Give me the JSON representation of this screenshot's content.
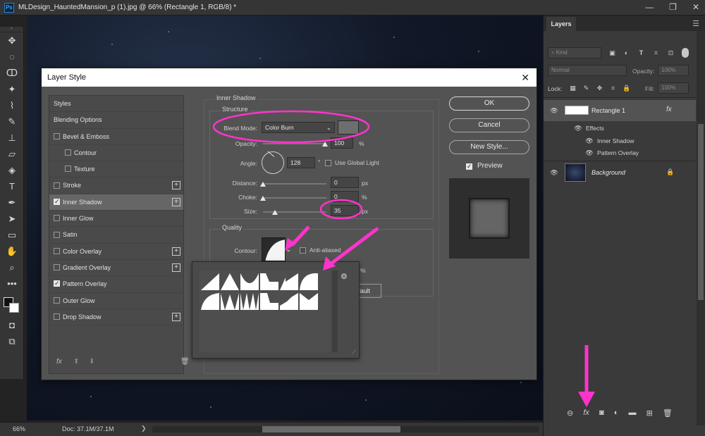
{
  "window": {
    "app_icon_label": "Ps",
    "title": "MLDesign_HauntedMansion_p (1).jpg @ 66% (Rectangle 1, RGB/8) *",
    "controls": [
      "—",
      "❐",
      "✕"
    ]
  },
  "statusbar": {
    "zoom": "66%",
    "doc": "Doc: 37.1M/37.1M",
    "arrow": "❯"
  },
  "layers_panel": {
    "tab": "Layers",
    "filter_placeholder": "Kind",
    "blend_mode": "Normal",
    "opacity_label": "Opacity:",
    "opacity_value": "100%",
    "lock_label": "Lock:",
    "fill_label": "Fill:",
    "fill_value": "100%",
    "layers": [
      {
        "name": "Rectangle 1",
        "fx": "fx"
      },
      {
        "name": "Background"
      }
    ],
    "effects_label": "Effects",
    "effects": [
      "Inner Shadow",
      "Pattern Overlay"
    ]
  },
  "dialog": {
    "title": "Layer Style",
    "close": "✕",
    "styles_header": "Styles",
    "style_items": [
      {
        "label": "Blending Options"
      },
      {
        "label": "Bevel & Emboss",
        "checked": false
      },
      {
        "label": "Contour",
        "checked": false,
        "sub": true
      },
      {
        "label": "Texture",
        "checked": false,
        "sub": true
      },
      {
        "label": "Stroke",
        "checked": false,
        "plus": true
      },
      {
        "label": "Inner Shadow",
        "checked": true,
        "plus": true,
        "selected": true
      },
      {
        "label": "Inner Glow",
        "checked": false
      },
      {
        "label": "Satin",
        "checked": false
      },
      {
        "label": "Color Overlay",
        "checked": false,
        "plus": true
      },
      {
        "label": "Gradient Overlay",
        "checked": false,
        "plus": true
      },
      {
        "label": "Pattern Overlay",
        "checked": true
      },
      {
        "label": "Outer Glow",
        "checked": false
      },
      {
        "label": "Drop Shadow",
        "checked": false,
        "plus": true
      }
    ],
    "inner_shadow": {
      "section_title": "Inner Shadow",
      "structure_title": "Structure",
      "blend_mode_label": "Blend Mode:",
      "blend_mode_value": "Color Burn",
      "shadow_color": "#6e6e6e",
      "opacity_label": "Opacity:",
      "opacity_value": "100",
      "angle_label": "Angle:",
      "angle_value": "128",
      "degree_symbol": "°",
      "global_light_label": "Use Global Light",
      "global_light_checked": false,
      "distance_label": "Distance:",
      "distance_value": "0",
      "choke_label": "Choke:",
      "choke_value": "0",
      "size_label": "Size:",
      "size_value": "35",
      "unit_px": "px",
      "unit_percent": "%",
      "quality_title": "Quality",
      "contour_label": "Contour:",
      "anti_aliased_label": "Anti-aliased",
      "anti_aliased_checked": false,
      "noise_unit": "%",
      "default_button_partial": "fault"
    },
    "buttons": {
      "ok": "OK",
      "cancel": "Cancel",
      "new_style": "New Style...",
      "preview_label": "Preview",
      "preview_checked": true
    },
    "footer_fx": "fx"
  },
  "colors": {
    "annotation": "#ff33cc",
    "panel_bg": "#535353",
    "app_bg": "#232323",
    "accent_blue": "#31a8ff"
  },
  "icons": {
    "toolbar": [
      "move-icon",
      "marquee-icon",
      "lasso-icon",
      "magic-wand-icon",
      "eyedropper-icon",
      "healing-brush-icon",
      "brush-icon",
      "clone-stamp-icon",
      "eraser-icon",
      "paint-bucket-icon",
      "pen-icon",
      "type-icon",
      "path-selection-icon",
      "rectangle-icon",
      "hand-icon",
      "zoom-icon",
      "more-tools-icon"
    ],
    "layers_bottom": [
      "link-icon",
      "fx-icon",
      "mask-icon",
      "adjustment-icon",
      "folder-icon",
      "new-layer-icon",
      "trash-icon"
    ]
  }
}
